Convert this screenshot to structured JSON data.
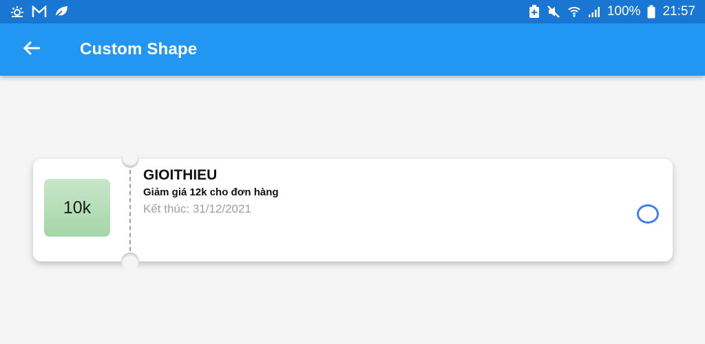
{
  "status_bar": {
    "left_icons": [
      "sun-settings-icon",
      "gmail-icon",
      "leaf-icon"
    ],
    "right_icons": [
      "battery-saver-icon",
      "mute-icon",
      "wifi-icon",
      "signal-icon",
      "battery-icon"
    ],
    "battery": "100%",
    "time": "21:57"
  },
  "app_bar": {
    "title": "Custom Shape",
    "back_icon": "arrow-back-icon"
  },
  "voucher": {
    "amount": "10k",
    "code": "GIOITHIEU",
    "description": "Giảm giá 12k cho đơn hàng",
    "expiry": "Kết thúc: 31/12/2021",
    "selected": false
  },
  "colors": {
    "status_bar": "#1976d2",
    "app_bar": "#2196f3",
    "background": "#f5f5f5",
    "badge": "#a5d6a7",
    "radio": "#3f7fe6"
  }
}
